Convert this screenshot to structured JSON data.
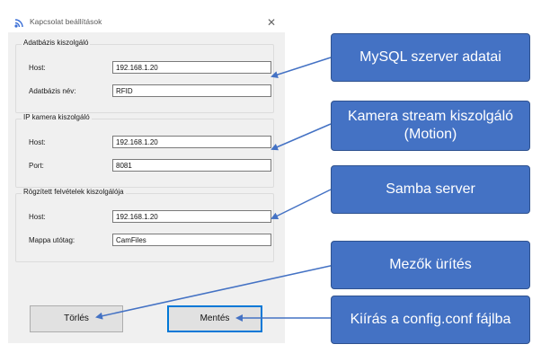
{
  "window": {
    "title": "Kapcsolat beállítások",
    "icon": "signal-icon",
    "close_glyph": "✕"
  },
  "groups": [
    {
      "title": "Adatbázis kiszolgáló",
      "fields": [
        {
          "label": "Host:",
          "value": "192.168.1.20"
        },
        {
          "label": "Adatbázis név:",
          "value": "RFID"
        }
      ]
    },
    {
      "title": "IP kamera kiszolgáló",
      "fields": [
        {
          "label": "Host:",
          "value": "192.168.1.20"
        },
        {
          "label": "Port:",
          "value": "8081"
        }
      ]
    },
    {
      "title": "Rögzített felvételek kiszolgálója",
      "fields": [
        {
          "label": "Host:",
          "value": "192.168.1.20"
        },
        {
          "label": "Mappa utótag:",
          "value": "CamFiles"
        }
      ]
    }
  ],
  "buttons": {
    "clear_label": "Törlés",
    "save_label": "Mentés"
  },
  "callouts": {
    "mysql": "MySQL szerver adatai",
    "camera_line1": "Kamera stream kiszolgáló",
    "camera_line2": "(Motion)",
    "samba": "Samba server",
    "clear": "Mezők ürítés",
    "save": "Kiírás a config.conf fájlba"
  },
  "colors": {
    "callout_fill": "#4472c4",
    "arrow": "#4472c4",
    "dialog_bg": "#f0f0f0",
    "primary_button_border": "#0078d7"
  }
}
